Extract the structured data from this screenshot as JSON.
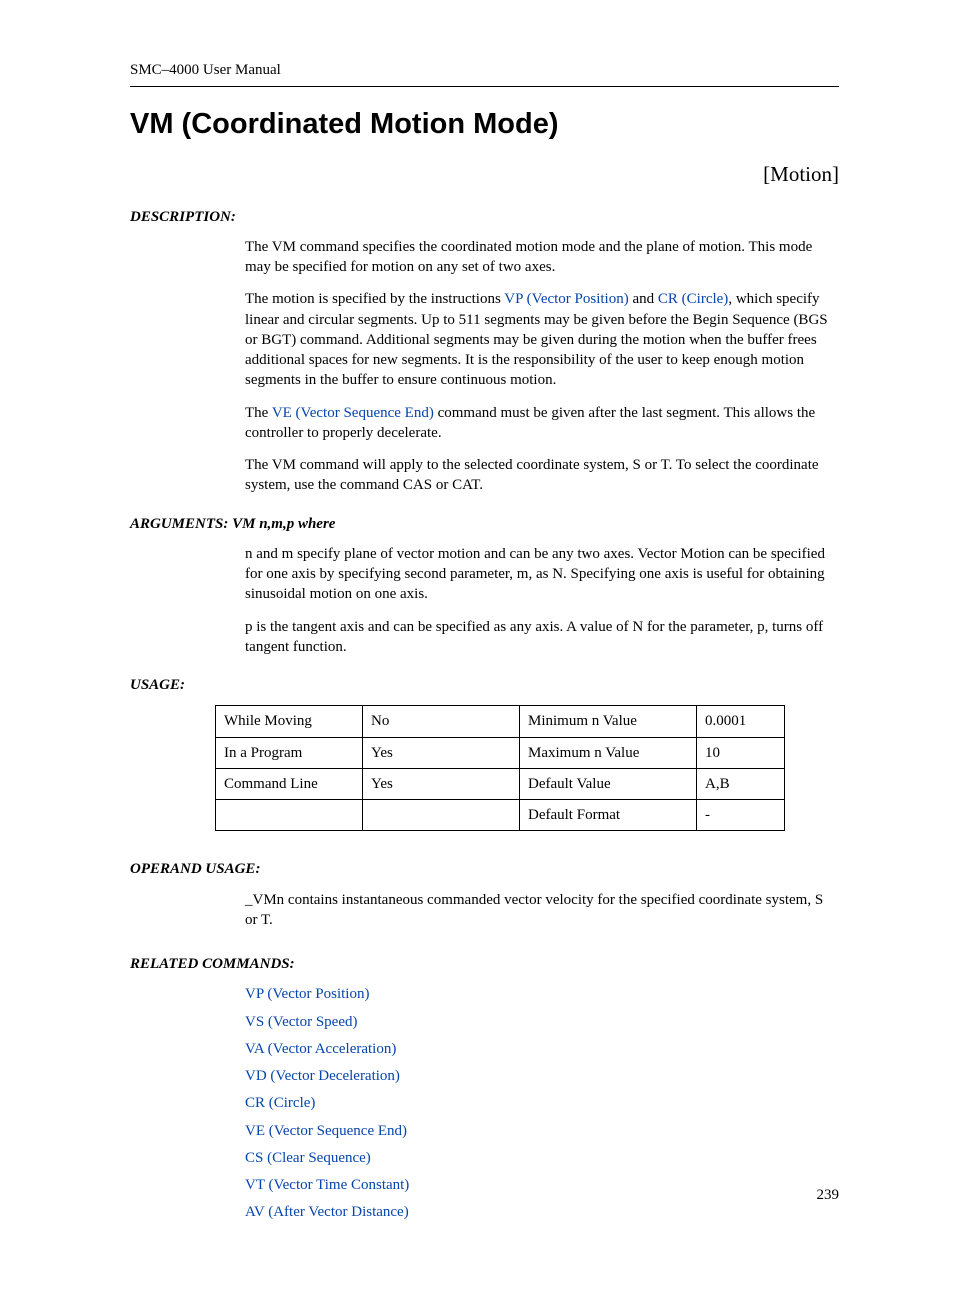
{
  "header": {
    "manual": "SMC–4000 User Manual"
  },
  "title": "VM (Coordinated Motion Mode)",
  "category": "[Motion]",
  "labels": {
    "description": "DESCRIPTION:",
    "arguments": "ARGUMENTS:  VM n,m,p   where",
    "usage": "USAGE:",
    "operand": "OPERAND USAGE:",
    "related": "RELATED COMMANDS:"
  },
  "description": {
    "p1": "The VM command specifies the coordinated motion mode and the plane of motion. This mode may be specified for motion on any set of two axes.",
    "p2a": "The motion is specified by the instructions ",
    "link_vp": "VP (Vector Position)",
    "p2b": " and ",
    "link_cr": "CR (Circle)",
    "p2c": ", which specify linear and circular segments. Up to 511 segments may be given before the Begin Sequence (BGS or BGT) command. Additional segments may be given during the motion when the buffer frees additional spaces for new segments. It is the responsibility of the user to keep enough motion segments in the buffer to ensure continuous motion.",
    "p3a": "The ",
    "link_ve": "VE (Vector Sequence End)",
    "p3b": " command must be given after the last segment. This allows the controller to properly decelerate.",
    "p4": "The VM command will apply to the selected coordinate system, S or T. To select the coordinate system, use the command CAS or CAT."
  },
  "arguments": {
    "p1": "n and m specify plane of vector motion and can be any two axes. Vector Motion can be specified for one axis by specifying second parameter, m, as N. Specifying one axis is useful for obtaining sinusoidal motion on one axis.",
    "p2": "p is the tangent axis and can be specified as any axis. A value of N for the parameter, p, turns off tangent function."
  },
  "usage_table": [
    [
      "While Moving",
      "No",
      "Minimum n Value",
      "0.0001"
    ],
    [
      "In a Program",
      "Yes",
      "Maximum n Value",
      "10"
    ],
    [
      "Command Line",
      "Yes",
      "Default Value",
      "A,B"
    ],
    [
      "",
      "",
      "Default Format",
      "-"
    ]
  ],
  "operand": {
    "p1": "_VMn contains instantaneous commanded vector velocity for the specified coordinate system, S or T."
  },
  "related": [
    "VP (Vector Position)",
    "VS (Vector Speed)",
    "VA (Vector Acceleration)",
    "VD (Vector Deceleration)",
    "CR (Circle)",
    "VE (Vector Sequence End)",
    "CS (Clear Sequence)",
    "VT (Vector Time Constant)",
    "AV (After Vector Distance)"
  ],
  "page_number": "239"
}
